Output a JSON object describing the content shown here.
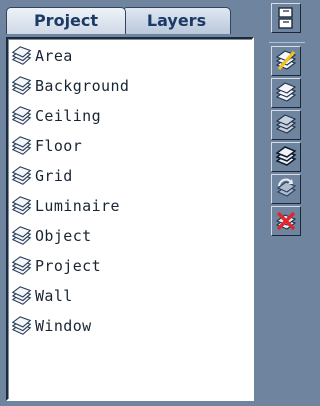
{
  "tabs": {
    "project": "Project",
    "layers": "Layers"
  },
  "layers": [
    "Area",
    "Background",
    "Ceiling",
    "Floor",
    "Grid",
    "Luminaire",
    "Object",
    "Project",
    "Wall",
    "Window"
  ],
  "icons": {
    "layer": "layers-icon",
    "top": "copy-layer-icon",
    "edit": "layer-edit-icon",
    "show_all": "show-all-layers-icon",
    "hide": "hide-layers-icon",
    "solid": "solid-layers-icon",
    "refresh": "refresh-layers-icon",
    "delete": "delete-layer-icon"
  },
  "colors": {
    "panel": "#6f849e",
    "tab_text": "#1b3a66",
    "delete": "#e0262a"
  }
}
